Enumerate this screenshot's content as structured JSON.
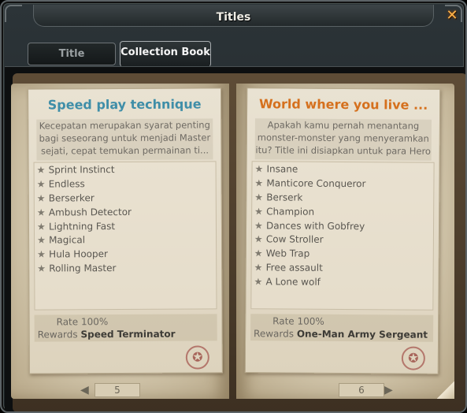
{
  "window": {
    "title": "Titles"
  },
  "tabs": [
    {
      "label": "Title",
      "active": false
    },
    {
      "label": "Collection Book",
      "active": true
    }
  ],
  "left_page": {
    "heading": "Speed play technique",
    "description": "Kecepatan merupakan syarat penting bagi seseorang untuk menjadi Master sejati, cepat temukan permainan ti...",
    "titles": [
      "Sprint Instinct",
      "Endless",
      "Berserker",
      "Ambush Detector",
      "Lightning Fast",
      "Magical",
      "Hula Hooper",
      "Rolling Master"
    ],
    "rate": "Rate 100%",
    "rewards_label": "Rewards",
    "rewards_value": "Speed Terminator",
    "page_number": "5"
  },
  "right_page": {
    "heading": "World where you live ...",
    "description": "Apakah kamu pernah menantang monster-monster yang menyeramkan itu? Title ini disiapkan untuk para Hero y...",
    "titles": [
      "Insane",
      "Manticore Conqueror",
      "Berserk",
      "Champion",
      "Dances with Gobfrey",
      "Cow Stroller",
      "Web Trap",
      "Free assault",
      "A Lone wolf"
    ],
    "rate": "Rate 100%",
    "rewards_label": "Rewards",
    "rewards_value": "One-Man Army Sergeant",
    "page_number": "6"
  },
  "icons": {
    "close": "close-icon",
    "star": "star-icon",
    "prev": "arrow-left-icon",
    "next": "arrow-right-icon"
  },
  "colors": {
    "left_heading": "#3f8ea8",
    "right_heading": "#d5701d",
    "close_accent": "#ffb34a"
  }
}
